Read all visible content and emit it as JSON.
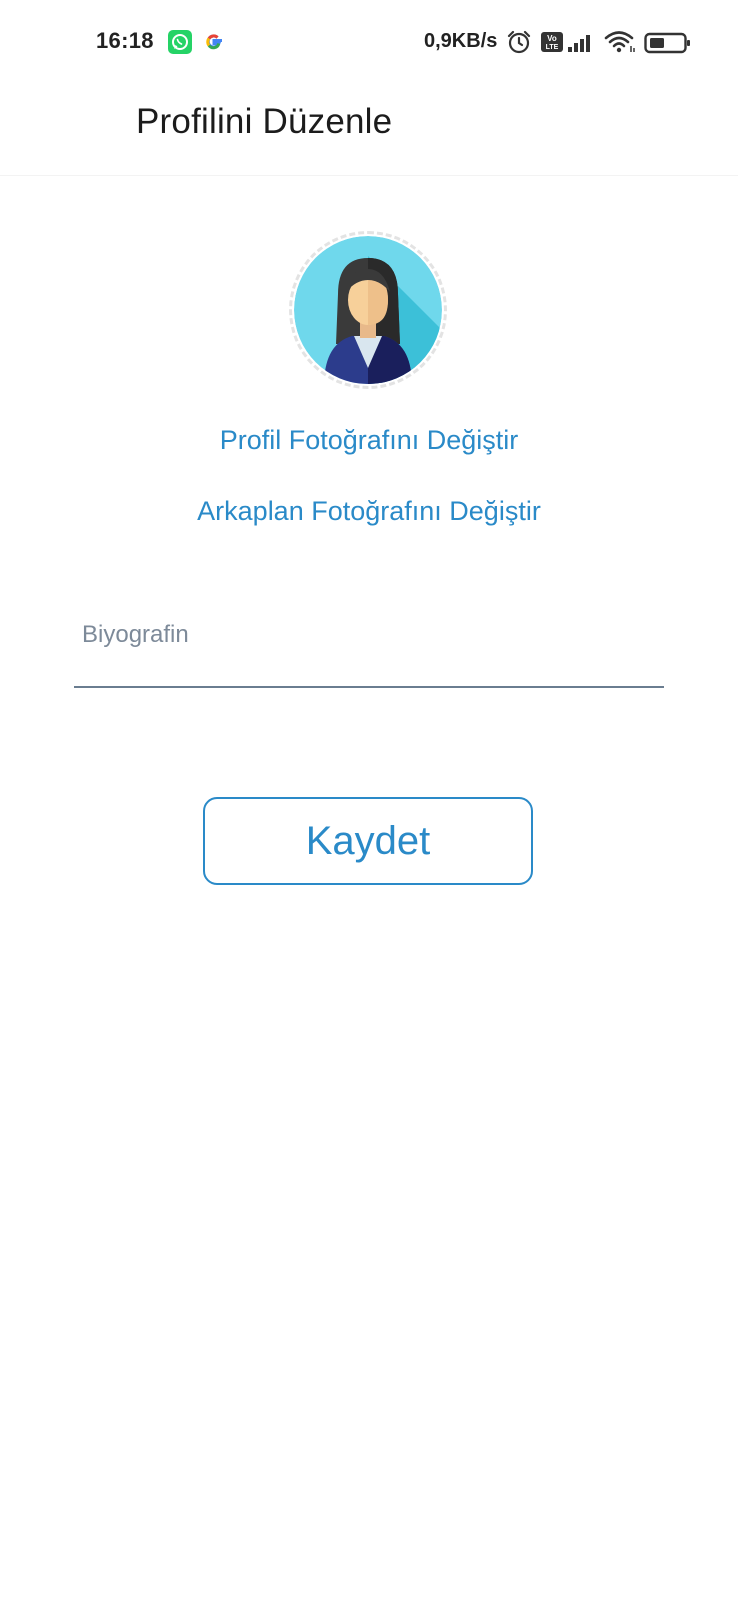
{
  "status_bar": {
    "time": "16:18",
    "net_speed": "0,9KB/s",
    "icons": [
      "whatsapp-icon",
      "google-icon",
      "alarm-icon",
      "volte-icon",
      "signal-icon",
      "wifi-icon",
      "battery-icon"
    ]
  },
  "app_bar": {
    "title": "Profilini Düzenle"
  },
  "profile": {
    "change_photo_label": "Profil Fotoğrafını Değiştir",
    "change_background_label": "Arkaplan Fotoğrafını Değiştir"
  },
  "bio": {
    "placeholder": "Biyografin",
    "value": ""
  },
  "actions": {
    "save_label": "Kaydet"
  },
  "colors": {
    "accent": "#2a8ac8",
    "avatar_bg": "#6fd8ec",
    "underline": "#6a7d90"
  }
}
